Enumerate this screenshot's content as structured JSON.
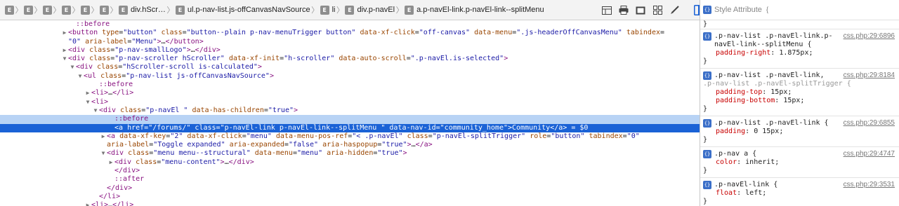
{
  "breadcrumbs": [
    {
      "badge": "E",
      "label": ""
    },
    {
      "badge": "E",
      "label": ""
    },
    {
      "badge": "E",
      "label": ""
    },
    {
      "badge": "E",
      "label": ""
    },
    {
      "badge": "E",
      "label": ""
    },
    {
      "badge": "E",
      "label": ""
    },
    {
      "badge": "E",
      "label": "div.hScr…"
    },
    {
      "badge": "E",
      "label": "ul.p-nav-list.js-offCanvasNavSource"
    },
    {
      "badge": "E",
      "label": "li"
    },
    {
      "badge": "E",
      "label": "div.p-navEl"
    },
    {
      "badge": "E",
      "label": "a.p-navEl-link.p-navEl-link--splitMenu"
    }
  ],
  "toolbar_icons": [
    "layout-icon",
    "print-icon",
    "screenshot-icon",
    "grid-icon",
    "brush-icon",
    "sidebar-toggle-icon"
  ],
  "dom_lines": [
    {
      "indent": 8,
      "twisty": "",
      "parts": [
        [
          "ps",
          "::before"
        ]
      ]
    },
    {
      "indent": 7,
      "twisty": "▶",
      "parts": [
        [
          "t",
          "<button "
        ],
        [
          "a",
          "type"
        ],
        [
          "p",
          "="
        ],
        [
          "v",
          "\"button\" "
        ],
        [
          "a",
          "class"
        ],
        [
          "p",
          "="
        ],
        [
          "v",
          "\"button--plain p-nav-menuTrigger button\" "
        ],
        [
          "a",
          "data-xf-click"
        ],
        [
          "p",
          "="
        ],
        [
          "v",
          "\"off-canvas\" "
        ],
        [
          "a",
          "data-menu"
        ],
        [
          "p",
          "="
        ],
        [
          "v",
          "\".js-headerOffCanvasMenu\" "
        ],
        [
          "a",
          "tabindex"
        ],
        [
          "p",
          "="
        ]
      ]
    },
    {
      "indent": 7,
      "twisty": "",
      "parts": [
        [
          "v",
          "\"0\" "
        ],
        [
          "a",
          "aria-label"
        ],
        [
          "p",
          "="
        ],
        [
          "v",
          "\"Menu\""
        ],
        [
          "t",
          ">"
        ],
        [
          "p",
          "…"
        ],
        [
          "t",
          "</button>"
        ]
      ]
    },
    {
      "indent": 7,
      "twisty": "▶",
      "parts": [
        [
          "t",
          "<div "
        ],
        [
          "a",
          "class"
        ],
        [
          "p",
          "="
        ],
        [
          "v",
          "\"p-nav-smallLogo\""
        ],
        [
          "t",
          ">"
        ],
        [
          "p",
          "…"
        ],
        [
          "t",
          "</div>"
        ]
      ]
    },
    {
      "indent": 7,
      "twisty": "▼",
      "parts": [
        [
          "t",
          "<div "
        ],
        [
          "a",
          "class"
        ],
        [
          "p",
          "="
        ],
        [
          "v",
          "\"p-nav-scroller hScroller\" "
        ],
        [
          "a",
          "data-xf-init"
        ],
        [
          "p",
          "="
        ],
        [
          "v",
          "\"h-scroller\" "
        ],
        [
          "a",
          "data-auto-scroll"
        ],
        [
          "p",
          "="
        ],
        [
          "v",
          "\".p-navEl.is-selected\""
        ],
        [
          "t",
          ">"
        ]
      ]
    },
    {
      "indent": 8,
      "twisty": "▼",
      "parts": [
        [
          "t",
          "<div "
        ],
        [
          "a",
          "class"
        ],
        [
          "p",
          "="
        ],
        [
          "v",
          "\"hScroller-scroll is-calculated\""
        ],
        [
          "t",
          ">"
        ]
      ]
    },
    {
      "indent": 9,
      "twisty": "▼",
      "parts": [
        [
          "t",
          "<ul "
        ],
        [
          "a",
          "class"
        ],
        [
          "p",
          "="
        ],
        [
          "v",
          "\"p-nav-list js-offCanvasNavSource\""
        ],
        [
          "t",
          ">"
        ]
      ]
    },
    {
      "indent": 11,
      "twisty": "",
      "parts": [
        [
          "ps",
          "::before"
        ]
      ]
    },
    {
      "indent": 10,
      "twisty": "▶",
      "parts": [
        [
          "t",
          "<li>"
        ],
        [
          "p",
          "…"
        ],
        [
          "t",
          "</li>"
        ]
      ]
    },
    {
      "indent": 10,
      "twisty": "▼",
      "parts": [
        [
          "t",
          "<li>"
        ]
      ]
    },
    {
      "indent": 11,
      "twisty": "▼",
      "parts": [
        [
          "t",
          "<div "
        ],
        [
          "a",
          "class"
        ],
        [
          "p",
          "="
        ],
        [
          "v",
          "\"p-navEl \" "
        ],
        [
          "a",
          "data-has-children"
        ],
        [
          "p",
          "="
        ],
        [
          "v",
          "\"true\""
        ],
        [
          "t",
          ">"
        ]
      ]
    },
    {
      "indent": 13,
      "twisty": "",
      "hl": "light",
      "parts": [
        [
          "ps",
          "::before"
        ]
      ]
    },
    {
      "indent": 13,
      "twisty": "",
      "hl": "strong",
      "parts": [
        [
          "t",
          "<a "
        ],
        [
          "a",
          "href"
        ],
        [
          "p",
          "="
        ],
        [
          "v",
          "\"/forums/\" "
        ],
        [
          "a",
          "class"
        ],
        [
          "p",
          "="
        ],
        [
          "v",
          "\"p-navEl-link p-navEl-link--splitMenu \" "
        ],
        [
          "a",
          "data-nav-id"
        ],
        [
          "p",
          "="
        ],
        [
          "v",
          "\"community_home\""
        ],
        [
          "t",
          ">"
        ],
        [
          "p",
          "Community"
        ],
        [
          "t",
          "</a>"
        ],
        [
          "p",
          " = $0"
        ]
      ]
    },
    {
      "indent": 12,
      "twisty": "▶",
      "parts": [
        [
          "t",
          "<a "
        ],
        [
          "a",
          "data-xf-key"
        ],
        [
          "p",
          "="
        ],
        [
          "v",
          "\"2\" "
        ],
        [
          "a",
          "data-xf-click"
        ],
        [
          "p",
          "="
        ],
        [
          "v",
          "\"menu\" "
        ],
        [
          "a",
          "data-menu-pos-ref"
        ],
        [
          "p",
          "="
        ],
        [
          "v",
          "\"< .p-navEl\" "
        ],
        [
          "a",
          "class"
        ],
        [
          "p",
          "="
        ],
        [
          "v",
          "\"p-navEl-splitTrigger\" "
        ],
        [
          "a",
          "role"
        ],
        [
          "p",
          "="
        ],
        [
          "v",
          "\"button\" "
        ],
        [
          "a",
          "tabindex"
        ],
        [
          "p",
          "="
        ],
        [
          "v",
          "\"0\""
        ]
      ]
    },
    {
      "indent": 12,
      "twisty": "",
      "parts": [
        [
          "a",
          "aria-label"
        ],
        [
          "p",
          "="
        ],
        [
          "v",
          "\"Toggle expanded\" "
        ],
        [
          "a",
          "aria-expanded"
        ],
        [
          "p",
          "="
        ],
        [
          "v",
          "\"false\" "
        ],
        [
          "a",
          "aria-haspopup"
        ],
        [
          "p",
          "="
        ],
        [
          "v",
          "\"true\""
        ],
        [
          "t",
          ">"
        ],
        [
          "p",
          "…"
        ],
        [
          "t",
          "</a>"
        ]
      ]
    },
    {
      "indent": 12,
      "twisty": "▼",
      "parts": [
        [
          "t",
          "<div "
        ],
        [
          "a",
          "class"
        ],
        [
          "p",
          "="
        ],
        [
          "v",
          "\"menu menu--structural\" "
        ],
        [
          "a",
          "data-menu"
        ],
        [
          "p",
          "="
        ],
        [
          "v",
          "\"menu\" "
        ],
        [
          "a",
          "aria-hidden"
        ],
        [
          "p",
          "="
        ],
        [
          "v",
          "\"true\""
        ],
        [
          "t",
          ">"
        ]
      ]
    },
    {
      "indent": 13,
      "twisty": "▶",
      "parts": [
        [
          "t",
          "<div "
        ],
        [
          "a",
          "class"
        ],
        [
          "p",
          "="
        ],
        [
          "v",
          "\"menu-content\""
        ],
        [
          "t",
          ">"
        ],
        [
          "p",
          "…"
        ],
        [
          "t",
          "</div>"
        ]
      ]
    },
    {
      "indent": 13,
      "twisty": "",
      "parts": [
        [
          "t",
          "</div>"
        ]
      ]
    },
    {
      "indent": 13,
      "twisty": "",
      "parts": [
        [
          "ps",
          "::after"
        ]
      ]
    },
    {
      "indent": 12,
      "twisty": "",
      "parts": [
        [
          "t",
          "</div>"
        ]
      ]
    },
    {
      "indent": 11,
      "twisty": "",
      "parts": [
        [
          "t",
          "</li>"
        ]
      ]
    },
    {
      "indent": 10,
      "twisty": "▶",
      "parts": [
        [
          "t",
          "<li>"
        ],
        [
          "p",
          "…"
        ],
        [
          "t",
          "</li>"
        ]
      ]
    }
  ],
  "styles": {
    "header_title": "Style Attribute",
    "header_brace": "{",
    "header_close": "}",
    "rules": [
      {
        "selector": ".p-nav-list .p-navEl-link.p-navEl-link--splitMenu",
        "source": "css.php:29:6896",
        "decls": [
          [
            "padding-right",
            "1.875px"
          ]
        ]
      },
      {
        "selector": ".p-nav-list .p-navEl-link,",
        "selector2": ".p-nav-list .p-navEl-splitTrigger",
        "source": "css.php:29:8184",
        "decls": [
          [
            "padding-top",
            "15px"
          ],
          [
            "padding-bottom",
            "15px"
          ]
        ]
      },
      {
        "selector": ".p-nav-list .p-navEl-link",
        "source": "css.php:29:6855",
        "decls": [
          [
            "padding",
            "0 15px"
          ]
        ]
      },
      {
        "selector": ".p-nav a",
        "source": "css.php:29:4747",
        "decls": [
          [
            "color",
            "inherit"
          ]
        ]
      },
      {
        "selector": ".p-navEl-link",
        "source": "css.php:29:3531",
        "decls": [
          [
            "float",
            "left"
          ]
        ]
      }
    ]
  },
  "colors": {
    "selection": "#1a62d6",
    "selection_light": "#b8d3f5",
    "tag": "#881280",
    "attr": "#994500",
    "value": "#1a1aa6"
  }
}
